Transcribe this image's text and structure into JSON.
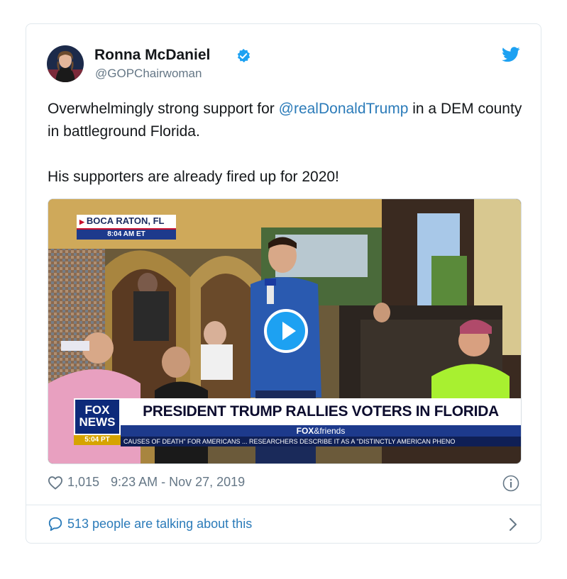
{
  "tweet": {
    "author_name": "Ronna McDaniel",
    "author_handle": "@GOPChairwoman",
    "text_before_mention": "Overwhelmingly strong support for ",
    "mention": "@realDonaldTrump",
    "text_after_mention": " in a DEM county in battleground Florida.",
    "text_second_paragraph": "His supporters are already fired up for 2020!",
    "likes": "1,015",
    "timestamp": "9:23 AM - Nov 27, 2019",
    "talking": "513 people are talking about this"
  },
  "video": {
    "location": "BOCA RATON, FL",
    "location_time": "8:04 AM ET",
    "network_logo_top": "FOX",
    "network_logo_bottom": "NEWS",
    "network_time": "5:04 PT",
    "headline": "PRESIDENT TRUMP RALLIES VOTERS IN FLORIDA",
    "show_fox": "FOX",
    "show_name": "&friends",
    "ticker": "CAUSES OF DEATH\" FOR AMERICANS ... RESEARCHERS DESCRIBE IT AS A \"DISTINCTLY AMERICAN PHENO"
  },
  "icons": {
    "verified": "verified-badge-icon",
    "bird": "twitter-bird-icon",
    "play": "play-icon",
    "heart": "heart-icon",
    "info": "info-icon",
    "bubble": "chat-bubble-icon",
    "chevron": "chevron-right-icon"
  },
  "colors": {
    "twitter_blue": "#1da1f2",
    "link_blue": "#2b7bb9",
    "gray": "#657786",
    "fox_navy": "#1d3a8c"
  }
}
